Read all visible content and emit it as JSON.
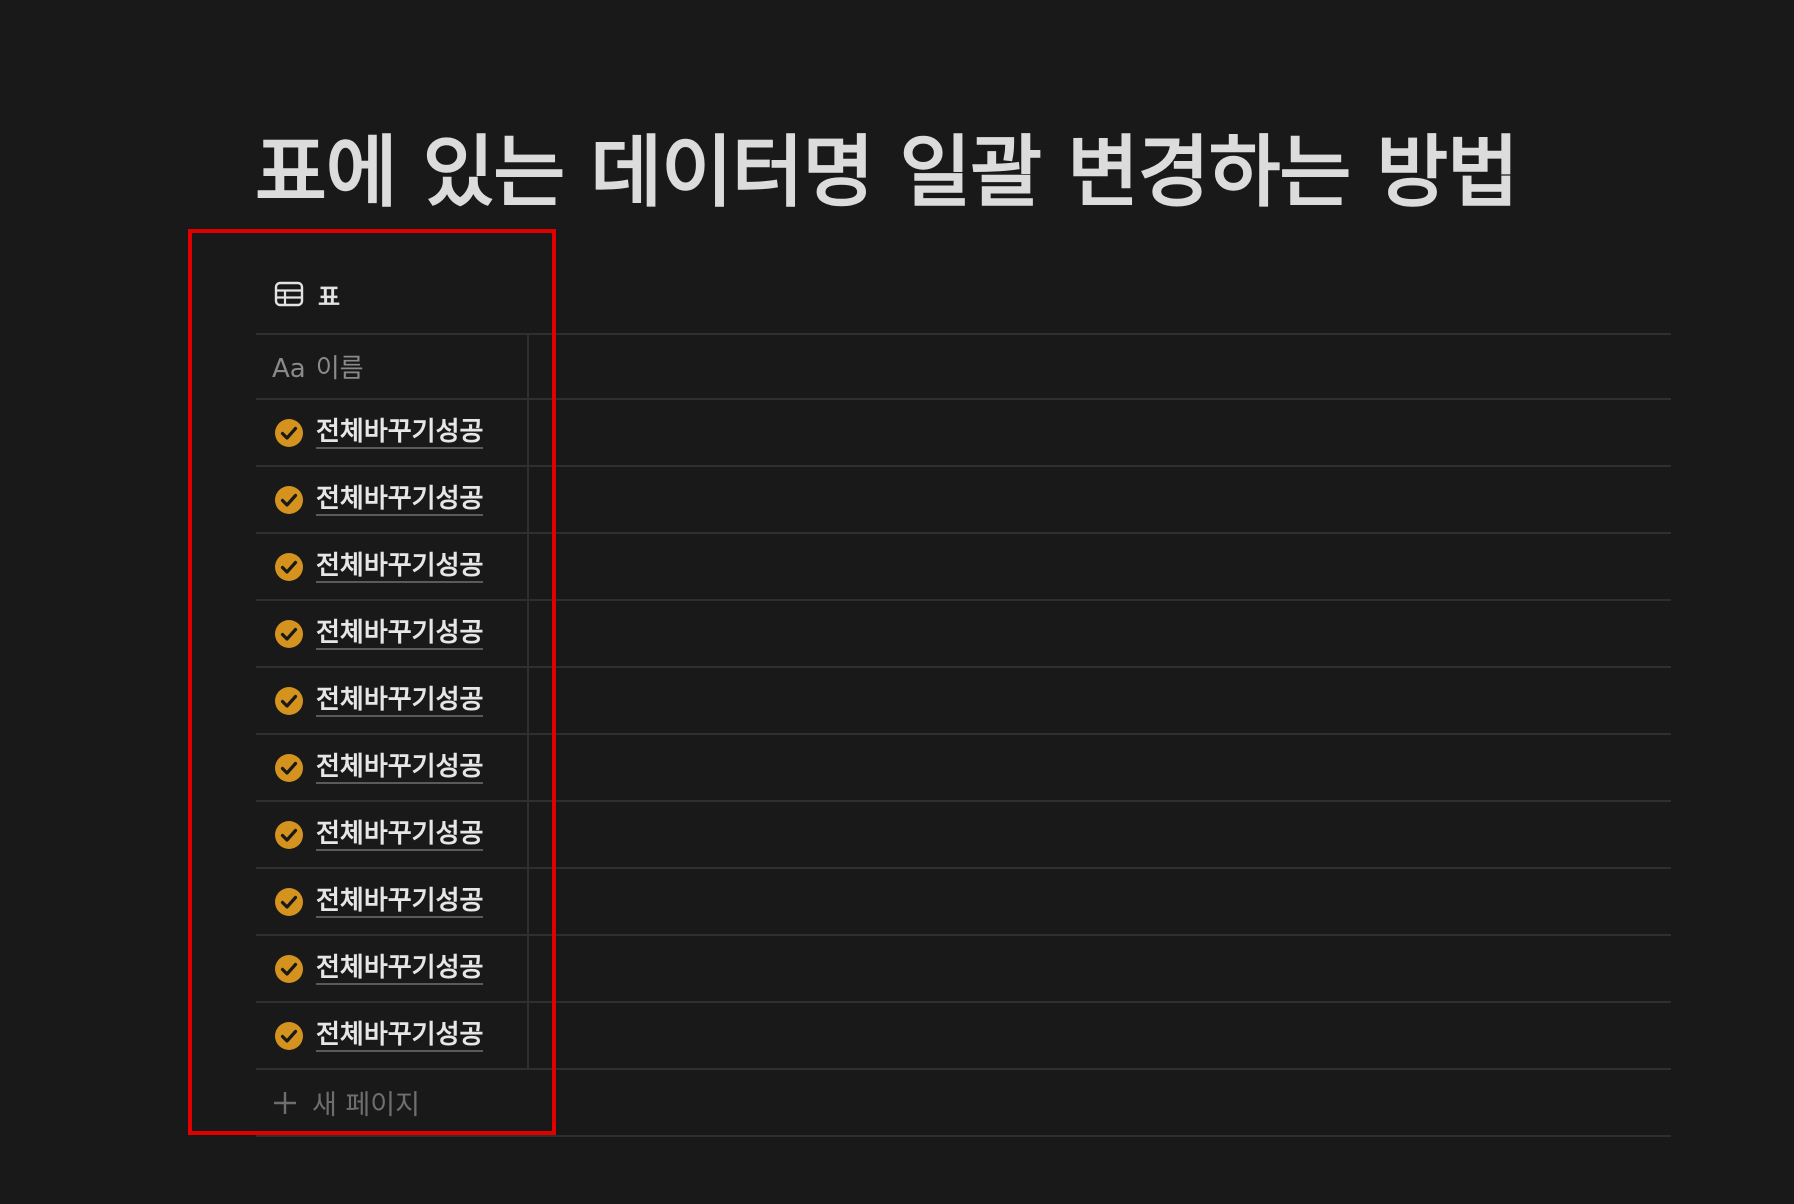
{
  "page": {
    "title": "표에 있는 데이터명 일괄 변경하는 방법"
  },
  "view": {
    "tab_label": "표",
    "tab_icon": "table-icon"
  },
  "table": {
    "name_column_prefix": "Aa",
    "name_column_label": "이름",
    "rows": [
      {
        "title": "전체바꾸기성공",
        "icon": "check-circle-icon"
      },
      {
        "title": "전체바꾸기성공",
        "icon": "check-circle-icon"
      },
      {
        "title": "전체바꾸기성공",
        "icon": "check-circle-icon"
      },
      {
        "title": "전체바꾸기성공",
        "icon": "check-circle-icon"
      },
      {
        "title": "전체바꾸기성공",
        "icon": "check-circle-icon"
      },
      {
        "title": "전체바꾸기성공",
        "icon": "check-circle-icon"
      },
      {
        "title": "전체바꾸기성공",
        "icon": "check-circle-icon"
      },
      {
        "title": "전체바꾸기성공",
        "icon": "check-circle-icon"
      },
      {
        "title": "전체바꾸기성공",
        "icon": "check-circle-icon"
      },
      {
        "title": "전체바꾸기성공",
        "icon": "check-circle-icon"
      }
    ],
    "new_page_label": "새 페이지"
  },
  "colors": {
    "background": "#191919",
    "check_icon": "#d4921f",
    "highlight_box": "#e00000"
  }
}
